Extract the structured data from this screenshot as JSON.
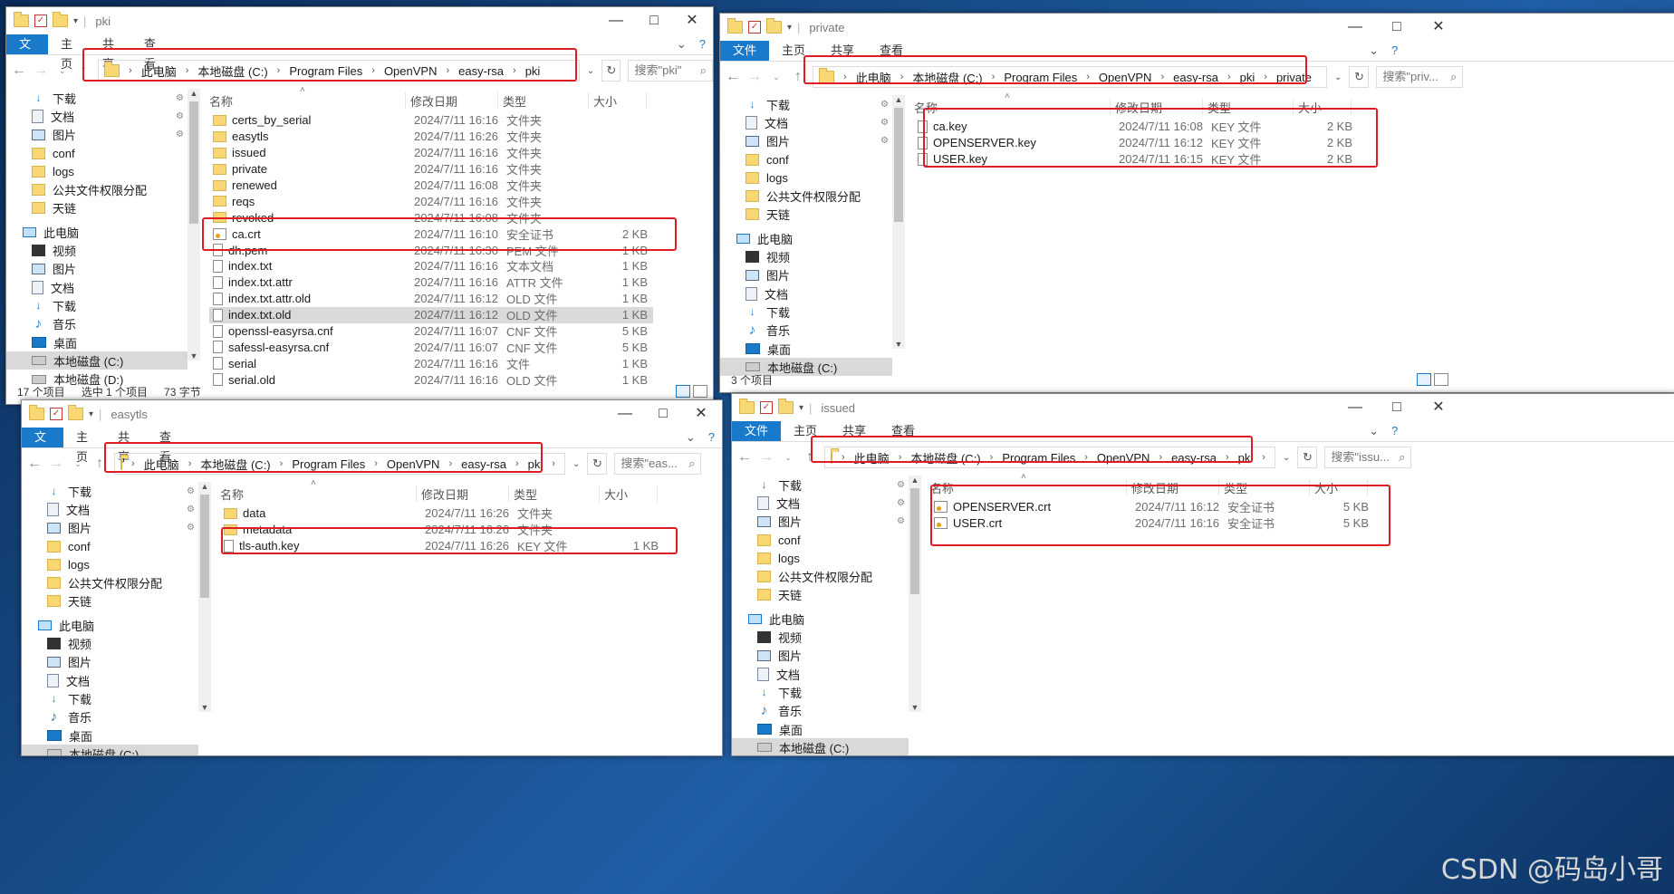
{
  "windows": [
    {
      "id": "pki",
      "title": "pki",
      "ribbon": [
        "文件",
        "主页",
        "共享",
        "查看"
      ],
      "path": [
        "此电脑",
        "本地磁盘 (C:)",
        "Program Files",
        "OpenVPN",
        "easy-rsa",
        "pki"
      ],
      "search_placeholder": "搜索\"pki\"",
      "headers": [
        "名称",
        "修改日期",
        "类型",
        "大小"
      ],
      "nav": [
        {
          "label": "下载",
          "icon": "download-icon",
          "pin": true
        },
        {
          "label": "文档",
          "icon": "document-icon",
          "pin": true
        },
        {
          "label": "图片",
          "icon": "picture-icon",
          "pin": true
        },
        {
          "label": "conf",
          "icon": "folder-icon"
        },
        {
          "label": "logs",
          "icon": "folder-icon"
        },
        {
          "label": "公共文件权限分配",
          "icon": "folder-icon"
        },
        {
          "label": "天链",
          "icon": "folder-icon"
        },
        {
          "label": "此电脑",
          "icon": "computer-icon"
        },
        {
          "label": "视频",
          "icon": "video-icon"
        },
        {
          "label": "图片",
          "icon": "picture-icon"
        },
        {
          "label": "文档",
          "icon": "document-icon"
        },
        {
          "label": "下载",
          "icon": "download-icon"
        },
        {
          "label": "音乐",
          "icon": "music-icon"
        },
        {
          "label": "桌面",
          "icon": "desktop-icon"
        },
        {
          "label": "本地磁盘 (C:)",
          "icon": "drive-icon",
          "selected": true
        },
        {
          "label": "本地磁盘 (D:)",
          "icon": "drive-icon"
        }
      ],
      "files": [
        {
          "name": "certs_by_serial",
          "date": "2024/7/11 16:16",
          "type": "文件夹",
          "size": "",
          "icon": "folder"
        },
        {
          "name": "easytls",
          "date": "2024/7/11 16:26",
          "type": "文件夹",
          "size": "",
          "icon": "folder"
        },
        {
          "name": "issued",
          "date": "2024/7/11 16:16",
          "type": "文件夹",
          "size": "",
          "icon": "folder"
        },
        {
          "name": "private",
          "date": "2024/7/11 16:16",
          "type": "文件夹",
          "size": "",
          "icon": "folder"
        },
        {
          "name": "renewed",
          "date": "2024/7/11 16:08",
          "type": "文件夹",
          "size": "",
          "icon": "folder"
        },
        {
          "name": "reqs",
          "date": "2024/7/11 16:16",
          "type": "文件夹",
          "size": "",
          "icon": "folder"
        },
        {
          "name": "revoked",
          "date": "2024/7/11 16:08",
          "type": "文件夹",
          "size": "",
          "icon": "folder"
        },
        {
          "name": "ca.crt",
          "date": "2024/7/11 16:10",
          "type": "安全证书",
          "size": "2 KB",
          "icon": "cert"
        },
        {
          "name": "dh.pem",
          "date": "2024/7/11 16:30",
          "type": "PEM 文件",
          "size": "1 KB",
          "icon": "file"
        },
        {
          "name": "index.txt",
          "date": "2024/7/11 16:16",
          "type": "文本文档",
          "size": "1 KB",
          "icon": "file"
        },
        {
          "name": "index.txt.attr",
          "date": "2024/7/11 16:16",
          "type": "ATTR 文件",
          "size": "1 KB",
          "icon": "file"
        },
        {
          "name": "index.txt.attr.old",
          "date": "2024/7/11 16:12",
          "type": "OLD 文件",
          "size": "1 KB",
          "icon": "file"
        },
        {
          "name": "index.txt.old",
          "date": "2024/7/11 16:12",
          "type": "OLD 文件",
          "size": "1 KB",
          "icon": "file",
          "selected": true
        },
        {
          "name": "openssl-easyrsa.cnf",
          "date": "2024/7/11 16:07",
          "type": "CNF 文件",
          "size": "5 KB",
          "icon": "file"
        },
        {
          "name": "safessl-easyrsa.cnf",
          "date": "2024/7/11 16:07",
          "type": "CNF 文件",
          "size": "5 KB",
          "icon": "file"
        },
        {
          "name": "serial",
          "date": "2024/7/11 16:16",
          "type": "文件",
          "size": "1 KB",
          "icon": "file"
        },
        {
          "name": "serial.old",
          "date": "2024/7/11 16:16",
          "type": "OLD 文件",
          "size": "1 KB",
          "icon": "file"
        }
      ],
      "status": [
        "17 个项目",
        "选中 1 个项目",
        "73 字节"
      ]
    },
    {
      "id": "private",
      "title": "private",
      "ribbon": [
        "文件",
        "主页",
        "共享",
        "查看"
      ],
      "path": [
        "此电脑",
        "本地磁盘 (C:)",
        "Program Files",
        "OpenVPN",
        "easy-rsa",
        "pki",
        "private"
      ],
      "search_placeholder": "搜索\"priv...",
      "headers": [
        "名称",
        "修改日期",
        "类型",
        "大小"
      ],
      "nav": [
        {
          "label": "下载",
          "icon": "download-icon",
          "pin": true
        },
        {
          "label": "文档",
          "icon": "document-icon",
          "pin": true
        },
        {
          "label": "图片",
          "icon": "picture-icon",
          "pin": true
        },
        {
          "label": "conf",
          "icon": "folder-icon"
        },
        {
          "label": "logs",
          "icon": "folder-icon"
        },
        {
          "label": "公共文件权限分配",
          "icon": "folder-icon"
        },
        {
          "label": "天链",
          "icon": "folder-icon"
        },
        {
          "label": "此电脑",
          "icon": "computer-icon"
        },
        {
          "label": "视频",
          "icon": "video-icon"
        },
        {
          "label": "图片",
          "icon": "picture-icon"
        },
        {
          "label": "文档",
          "icon": "document-icon"
        },
        {
          "label": "下载",
          "icon": "download-icon"
        },
        {
          "label": "音乐",
          "icon": "music-icon"
        },
        {
          "label": "桌面",
          "icon": "desktop-icon"
        },
        {
          "label": "本地磁盘 (C:)",
          "icon": "drive-icon",
          "selected": true
        }
      ],
      "files": [
        {
          "name": "ca.key",
          "date": "2024/7/11 16:08",
          "type": "KEY 文件",
          "size": "2 KB",
          "icon": "file"
        },
        {
          "name": "OPENSERVER.key",
          "date": "2024/7/11 16:12",
          "type": "KEY 文件",
          "size": "2 KB",
          "icon": "file"
        },
        {
          "name": "USER.key",
          "date": "2024/7/11 16:15",
          "type": "KEY 文件",
          "size": "2 KB",
          "icon": "file"
        }
      ],
      "status": [
        "3 个项目"
      ]
    },
    {
      "id": "easytls",
      "title": "easytls",
      "ribbon": [
        "文件",
        "主页",
        "共享",
        "查看"
      ],
      "path": [
        "此电脑",
        "本地磁盘 (C:)",
        "Program Files",
        "OpenVPN",
        "easy-rsa",
        "pki",
        "easytls"
      ],
      "search_placeholder": "搜索\"eas...",
      "headers": [
        "名称",
        "修改日期",
        "类型",
        "大小"
      ],
      "nav": [
        {
          "label": "下载",
          "icon": "download-icon",
          "pin": true
        },
        {
          "label": "文档",
          "icon": "document-icon",
          "pin": true
        },
        {
          "label": "图片",
          "icon": "picture-icon",
          "pin": true
        },
        {
          "label": "conf",
          "icon": "folder-icon"
        },
        {
          "label": "logs",
          "icon": "folder-icon"
        },
        {
          "label": "公共文件权限分配",
          "icon": "folder-icon"
        },
        {
          "label": "天链",
          "icon": "folder-icon"
        },
        {
          "label": "此电脑",
          "icon": "computer-icon"
        },
        {
          "label": "视频",
          "icon": "video-icon"
        },
        {
          "label": "图片",
          "icon": "picture-icon"
        },
        {
          "label": "文档",
          "icon": "document-icon"
        },
        {
          "label": "下载",
          "icon": "download-icon"
        },
        {
          "label": "音乐",
          "icon": "music-icon"
        },
        {
          "label": "桌面",
          "icon": "desktop-icon"
        },
        {
          "label": "本地磁盘 (C:)",
          "icon": "drive-icon",
          "selected": true
        }
      ],
      "files": [
        {
          "name": "data",
          "date": "2024/7/11 16:26",
          "type": "文件夹",
          "size": "",
          "icon": "folder"
        },
        {
          "name": "metadata",
          "date": "2024/7/11 16:26",
          "type": "文件夹",
          "size": "",
          "icon": "folder"
        },
        {
          "name": "tls-auth.key",
          "date": "2024/7/11 16:26",
          "type": "KEY 文件",
          "size": "1 KB",
          "icon": "file"
        }
      ],
      "status": []
    },
    {
      "id": "issued",
      "title": "issued",
      "ribbon": [
        "文件",
        "主页",
        "共享",
        "查看"
      ],
      "path": [
        "此电脑",
        "本地磁盘 (C:)",
        "Program Files",
        "OpenVPN",
        "easy-rsa",
        "pki",
        "issued"
      ],
      "search_placeholder": "搜索\"issu...",
      "headers": [
        "名称",
        "修改日期",
        "类型",
        "大小"
      ],
      "nav": [
        {
          "label": "下载",
          "icon": "download-icon",
          "pin": true
        },
        {
          "label": "文档",
          "icon": "document-icon",
          "pin": true
        },
        {
          "label": "图片",
          "icon": "picture-icon",
          "pin": true
        },
        {
          "label": "conf",
          "icon": "folder-icon"
        },
        {
          "label": "logs",
          "icon": "folder-icon"
        },
        {
          "label": "公共文件权限分配",
          "icon": "folder-icon"
        },
        {
          "label": "天链",
          "icon": "folder-icon"
        },
        {
          "label": "此电脑",
          "icon": "computer-icon"
        },
        {
          "label": "视频",
          "icon": "video-icon"
        },
        {
          "label": "图片",
          "icon": "picture-icon"
        },
        {
          "label": "文档",
          "icon": "document-icon"
        },
        {
          "label": "下载",
          "icon": "download-icon"
        },
        {
          "label": "音乐",
          "icon": "music-icon"
        },
        {
          "label": "桌面",
          "icon": "desktop-icon"
        },
        {
          "label": "本地磁盘 (C:)",
          "icon": "drive-icon",
          "selected": true
        }
      ],
      "files": [
        {
          "name": "OPENSERVER.crt",
          "date": "2024/7/11 16:12",
          "type": "安全证书",
          "size": "5 KB",
          "icon": "cert"
        },
        {
          "name": "USER.crt",
          "date": "2024/7/11 16:16",
          "type": "安全证书",
          "size": "5 KB",
          "icon": "cert"
        }
      ],
      "status": []
    }
  ],
  "watermark": "CSDN @码岛小哥",
  "colors": {
    "accent": "#1979ca",
    "highlight": "#e01b24",
    "selection": "#d9d9d9"
  }
}
